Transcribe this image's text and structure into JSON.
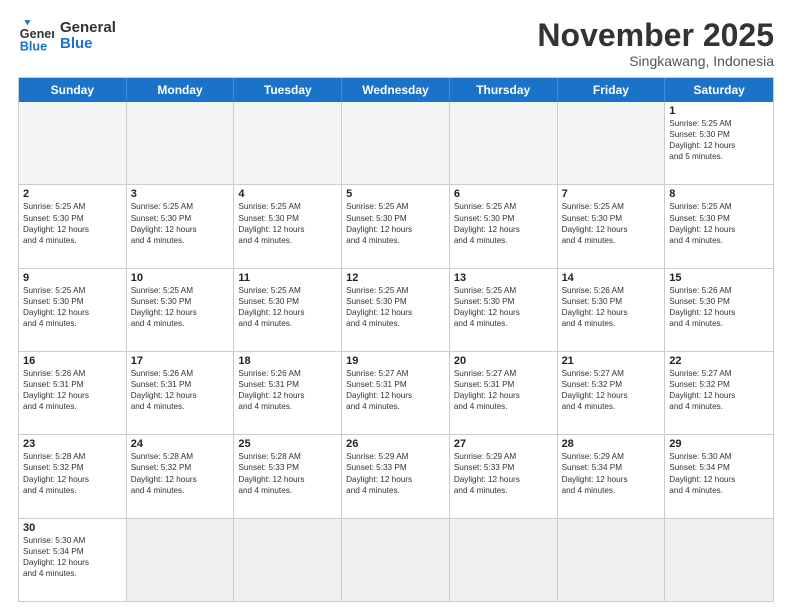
{
  "logo": {
    "general": "General",
    "blue": "Blue"
  },
  "title": "November 2025",
  "subtitle": "Singkawang, Indonesia",
  "days": [
    "Sunday",
    "Monday",
    "Tuesday",
    "Wednesday",
    "Thursday",
    "Friday",
    "Saturday"
  ],
  "rows": [
    [
      {
        "day": "",
        "info": "",
        "empty": true
      },
      {
        "day": "",
        "info": "",
        "empty": true
      },
      {
        "day": "",
        "info": "",
        "empty": true
      },
      {
        "day": "",
        "info": "",
        "empty": true
      },
      {
        "day": "",
        "info": "",
        "empty": true
      },
      {
        "day": "",
        "info": "",
        "empty": true
      },
      {
        "day": "1",
        "info": "Sunrise: 5:25 AM\nSunset: 5:30 PM\nDaylight: 12 hours\nand 5 minutes."
      }
    ],
    [
      {
        "day": "2",
        "info": "Sunrise: 5:25 AM\nSunset: 5:30 PM\nDaylight: 12 hours\nand 4 minutes."
      },
      {
        "day": "3",
        "info": "Sunrise: 5:25 AM\nSunset: 5:30 PM\nDaylight: 12 hours\nand 4 minutes."
      },
      {
        "day": "4",
        "info": "Sunrise: 5:25 AM\nSunset: 5:30 PM\nDaylight: 12 hours\nand 4 minutes."
      },
      {
        "day": "5",
        "info": "Sunrise: 5:25 AM\nSunset: 5:30 PM\nDaylight: 12 hours\nand 4 minutes."
      },
      {
        "day": "6",
        "info": "Sunrise: 5:25 AM\nSunset: 5:30 PM\nDaylight: 12 hours\nand 4 minutes."
      },
      {
        "day": "7",
        "info": "Sunrise: 5:25 AM\nSunset: 5:30 PM\nDaylight: 12 hours\nand 4 minutes."
      },
      {
        "day": "8",
        "info": "Sunrise: 5:25 AM\nSunset: 5:30 PM\nDaylight: 12 hours\nand 4 minutes."
      }
    ],
    [
      {
        "day": "9",
        "info": "Sunrise: 5:25 AM\nSunset: 5:30 PM\nDaylight: 12 hours\nand 4 minutes."
      },
      {
        "day": "10",
        "info": "Sunrise: 5:25 AM\nSunset: 5:30 PM\nDaylight: 12 hours\nand 4 minutes."
      },
      {
        "day": "11",
        "info": "Sunrise: 5:25 AM\nSunset: 5:30 PM\nDaylight: 12 hours\nand 4 minutes."
      },
      {
        "day": "12",
        "info": "Sunrise: 5:25 AM\nSunset: 5:30 PM\nDaylight: 12 hours\nand 4 minutes."
      },
      {
        "day": "13",
        "info": "Sunrise: 5:25 AM\nSunset: 5:30 PM\nDaylight: 12 hours\nand 4 minutes."
      },
      {
        "day": "14",
        "info": "Sunrise: 5:26 AM\nSunset: 5:30 PM\nDaylight: 12 hours\nand 4 minutes."
      },
      {
        "day": "15",
        "info": "Sunrise: 5:26 AM\nSunset: 5:30 PM\nDaylight: 12 hours\nand 4 minutes."
      }
    ],
    [
      {
        "day": "16",
        "info": "Sunrise: 5:26 AM\nSunset: 5:31 PM\nDaylight: 12 hours\nand 4 minutes."
      },
      {
        "day": "17",
        "info": "Sunrise: 5:26 AM\nSunset: 5:31 PM\nDaylight: 12 hours\nand 4 minutes."
      },
      {
        "day": "18",
        "info": "Sunrise: 5:26 AM\nSunset: 5:31 PM\nDaylight: 12 hours\nand 4 minutes."
      },
      {
        "day": "19",
        "info": "Sunrise: 5:27 AM\nSunset: 5:31 PM\nDaylight: 12 hours\nand 4 minutes."
      },
      {
        "day": "20",
        "info": "Sunrise: 5:27 AM\nSunset: 5:31 PM\nDaylight: 12 hours\nand 4 minutes."
      },
      {
        "day": "21",
        "info": "Sunrise: 5:27 AM\nSunset: 5:32 PM\nDaylight: 12 hours\nand 4 minutes."
      },
      {
        "day": "22",
        "info": "Sunrise: 5:27 AM\nSunset: 5:32 PM\nDaylight: 12 hours\nand 4 minutes."
      }
    ],
    [
      {
        "day": "23",
        "info": "Sunrise: 5:28 AM\nSunset: 5:32 PM\nDaylight: 12 hours\nand 4 minutes."
      },
      {
        "day": "24",
        "info": "Sunrise: 5:28 AM\nSunset: 5:32 PM\nDaylight: 12 hours\nand 4 minutes."
      },
      {
        "day": "25",
        "info": "Sunrise: 5:28 AM\nSunset: 5:33 PM\nDaylight: 12 hours\nand 4 minutes."
      },
      {
        "day": "26",
        "info": "Sunrise: 5:29 AM\nSunset: 5:33 PM\nDaylight: 12 hours\nand 4 minutes."
      },
      {
        "day": "27",
        "info": "Sunrise: 5:29 AM\nSunset: 5:33 PM\nDaylight: 12 hours\nand 4 minutes."
      },
      {
        "day": "28",
        "info": "Sunrise: 5:29 AM\nSunset: 5:34 PM\nDaylight: 12 hours\nand 4 minutes."
      },
      {
        "day": "29",
        "info": "Sunrise: 5:30 AM\nSunset: 5:34 PM\nDaylight: 12 hours\nand 4 minutes."
      }
    ],
    [
      {
        "day": "30",
        "info": "Sunrise: 5:30 AM\nSunset: 5:34 PM\nDaylight: 12 hours\nand 4 minutes."
      },
      {
        "day": "",
        "info": "",
        "empty": true,
        "shaded": true
      },
      {
        "day": "",
        "info": "",
        "empty": true,
        "shaded": true
      },
      {
        "day": "",
        "info": "",
        "empty": true,
        "shaded": true
      },
      {
        "day": "",
        "info": "",
        "empty": true,
        "shaded": true
      },
      {
        "day": "",
        "info": "",
        "empty": true,
        "shaded": true
      },
      {
        "day": "",
        "info": "",
        "empty": true,
        "shaded": true
      }
    ]
  ]
}
